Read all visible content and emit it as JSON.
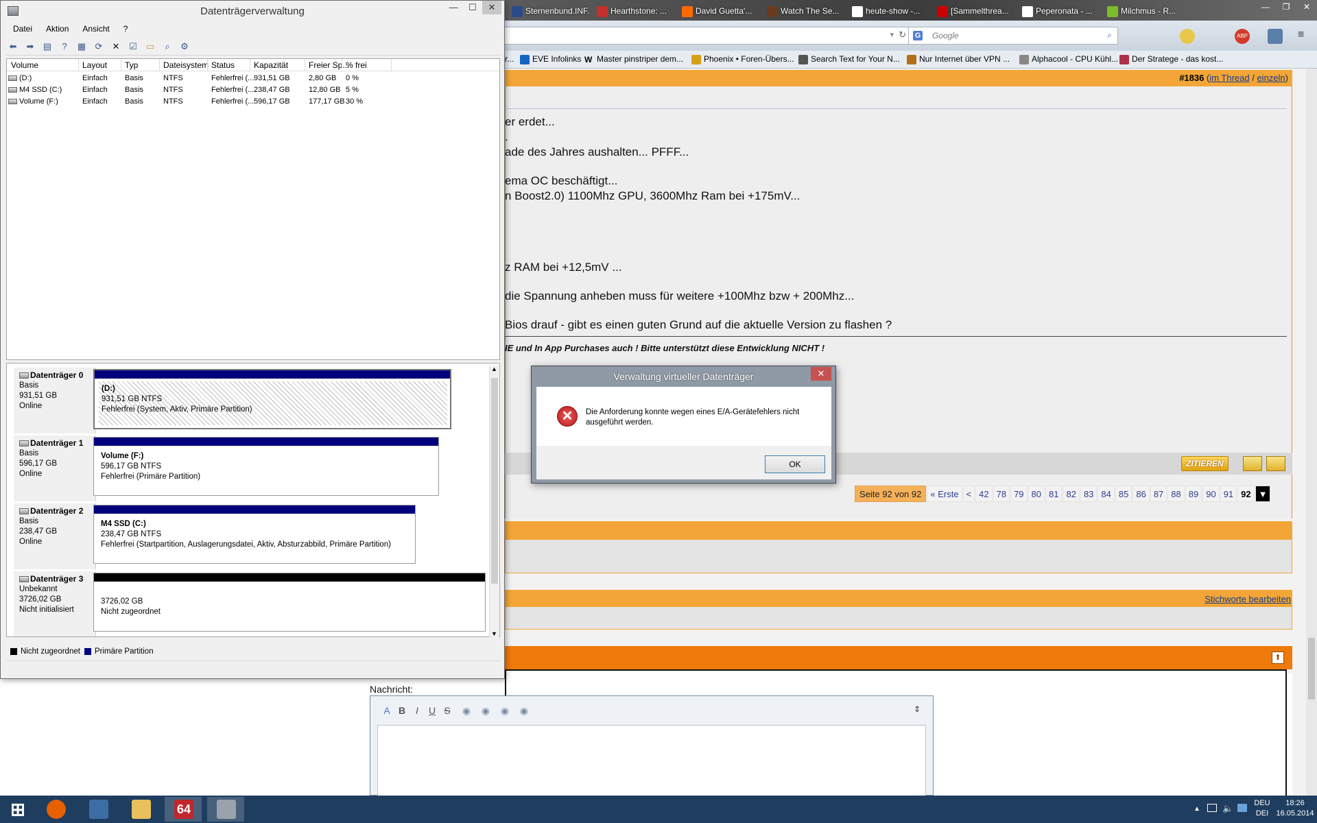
{
  "browser": {
    "tabs": [
      {
        "label": "Sternenbund.INF...",
        "color": "#2a4a8a"
      },
      {
        "label": "Hearthstone: ...",
        "color": "#c4302b"
      },
      {
        "label": "David Guetta'...",
        "color": "#ff6a00"
      },
      {
        "label": "Watch The Se...",
        "color": "#6b3a1e"
      },
      {
        "label": "heute-show -...",
        "color": "#ffffff"
      },
      {
        "label": "[Sammelthrea...",
        "color": "#cc0000"
      },
      {
        "label": "Peperonata - ...",
        "color": "#ffffff"
      },
      {
        "label": "Milchmus - R...",
        "color": "#7dbd2a"
      }
    ],
    "search_placeholder": "Google",
    "search_engine_icon": "G",
    "bookmarks": [
      {
        "label": "EVE Infolinks",
        "color": "#1565c0"
      },
      {
        "label": "Master pinstriper dem...",
        "color": "#000000",
        "glyph": "W"
      },
      {
        "label": "Phoenix • Foren-Übers...",
        "color": "#d4a017"
      },
      {
        "label": "Search Text for Your N...",
        "color": "#555555"
      },
      {
        "label": "Nur Internet über VPN ...",
        "color": "#b0701a"
      },
      {
        "label": "Alphacool - CPU Kühl...",
        "color": "#888888"
      },
      {
        "label": "Der Stratege - das kost...",
        "color": "#b0304a"
      }
    ],
    "bookmark_truncated_prefix": "r..."
  },
  "forum": {
    "post_number": "#1836",
    "post_links": {
      "thread": "im Thread",
      "single": "einzeln"
    },
    "lines": [
      "er erdet...",
      ".",
      "ade des Jahres aushalten... PFFF...",
      "ema OC beschäftigt...",
      "n Boost2.0) 1100Mhz GPU, 3600Mhz Ram bei +175mV...",
      "z RAM bei +12,5mV ...",
      "die Spannung anheben muss für weitere +100Mhz bzw + 200Mhz...",
      " Bios drauf - gibt es einen guten Grund auf die aktuelle Version zu flashen ?"
    ],
    "signature": "IE und In App Purchases auch ! Bitte unterstützt diese Entwicklung NICHT !",
    "quote_button": "ZITIEREN",
    "pager": {
      "label": "Seite 92 von 92",
      "first": "« Erste",
      "prev": "<",
      "pages": [
        "42",
        "78",
        "79",
        "80",
        "81",
        "82",
        "83",
        "84",
        "85",
        "86",
        "87",
        "88",
        "89",
        "90",
        "91"
      ],
      "current": "92"
    },
    "tags_link": "Stichworte bearbeiten",
    "message_label": "Nachricht:",
    "editor_buttons": [
      "A",
      "B",
      "I",
      "U",
      "S"
    ]
  },
  "disk_mgmt": {
    "title": "Datenträgerverwaltung",
    "menu": [
      "Datei",
      "Aktion",
      "Ansicht",
      "?"
    ],
    "columns": [
      "Volume",
      "Layout",
      "Typ",
      "Dateisystem",
      "Status",
      "Kapazität",
      "Freier Sp...",
      "% frei"
    ],
    "volumes": [
      [
        "(D:)",
        "Einfach",
        "Basis",
        "NTFS",
        "Fehlerfrei (...",
        "931,51 GB",
        "2,80 GB",
        "0 %"
      ],
      [
        "M4 SSD (C:)",
        "Einfach",
        "Basis",
        "NTFS",
        "Fehlerfrei (...",
        "238,47 GB",
        "12,80 GB",
        "5 %"
      ],
      [
        "Volume (F:)",
        "Einfach",
        "Basis",
        "NTFS",
        "Fehlerfrei (...",
        "596,17 GB",
        "177,17 GB",
        "30 %"
      ]
    ],
    "disks": [
      {
        "name": "Datenträger 0",
        "type": "Basis",
        "size": "931,51 GB",
        "state": "Online",
        "part_title": "(D:)",
        "part_size": "931,51 GB NTFS",
        "part_status": "Fehlerfrei (System, Aktiv, Primäre Partition)"
      },
      {
        "name": "Datenträger 1",
        "type": "Basis",
        "size": "596,17 GB",
        "state": "Online",
        "part_title": "Volume  (F:)",
        "part_size": "596,17 GB NTFS",
        "part_status": "Fehlerfrei (Primäre Partition)"
      },
      {
        "name": "Datenträger 2",
        "type": "Basis",
        "size": "238,47 GB",
        "state": "Online",
        "part_title": "M4 SSD  (C:)",
        "part_size": "238,47 GB NTFS",
        "part_status": "Fehlerfrei (Startpartition, Auslagerungsdatei, Aktiv, Absturzabbild, Primäre Partition)"
      },
      {
        "name": "Datenträger 3",
        "type": "Unbekannt",
        "size": "3726,02 GB",
        "state": "Nicht initialisiert",
        "part_title": "",
        "part_size": "3726,02 GB",
        "part_status": "Nicht zugeordnet"
      }
    ],
    "legend": [
      {
        "label": "Nicht zugeordnet",
        "color": "#000000"
      },
      {
        "label": "Primäre Partition",
        "color": "#00007c"
      }
    ]
  },
  "dialog": {
    "title": "Verwaltung virtueller Datenträger",
    "message": "Die Anforderung konnte wegen eines E/A-Gerätefehlers nicht ausgeführt werden.",
    "ok": "OK"
  },
  "taskbar": {
    "apps": [
      {
        "name": "start",
        "color": "#ffffff"
      },
      {
        "name": "firefox",
        "color": "#e66000"
      },
      {
        "name": "thunderbird",
        "color": "#3b6ea5"
      },
      {
        "name": "explorer",
        "color": "#e8c15a"
      },
      {
        "name": "aida64",
        "color": "#c0262c",
        "label": "64"
      },
      {
        "name": "disk-management",
        "color": "#9aa3ab"
      }
    ],
    "lang_top": "DEU",
    "lang_bottom": "DEI",
    "time": "18:26",
    "date": "16.05.2014"
  }
}
